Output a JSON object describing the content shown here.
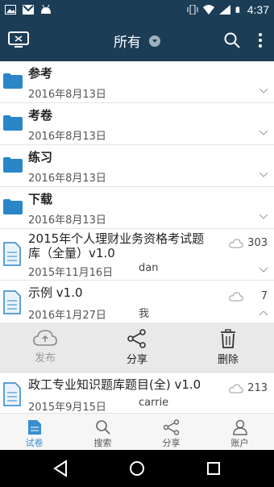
{
  "status_bar": {
    "time": "4:37"
  },
  "app_bar": {
    "title": "所有"
  },
  "folders": [
    {
      "name": "参考",
      "date": "2016年8月13日"
    },
    {
      "name": "考卷",
      "date": "2016年8月13日"
    },
    {
      "name": "练习",
      "date": "2016年8月13日"
    },
    {
      "name": "下载",
      "date": "2016年8月13日"
    }
  ],
  "files": [
    {
      "name_line1": "2015年个人理财业务资格考试题",
      "name_line2": "库（全量）v1.0",
      "date": "2015年11月16日",
      "author": "dan",
      "count": "303"
    },
    {
      "name_line1": "示例 v1.0",
      "name_line2": "",
      "date": "2016年1月27日",
      "author": "我",
      "count": "7"
    },
    {
      "name_line1": "政工专业知识题库题目(全) v1.0",
      "name_line2": "",
      "date": "2015年9月15日",
      "author": "carrie",
      "count": "213"
    }
  ],
  "actions": {
    "publish": "发布",
    "share": "分享",
    "delete": "删除"
  },
  "tabs": {
    "papers": "试卷",
    "search": "搜索",
    "share": "分享",
    "account": "账户"
  },
  "colors": {
    "primary": "#1c3d56",
    "accent": "#3a8fd1",
    "folder": "#2a86c8"
  }
}
